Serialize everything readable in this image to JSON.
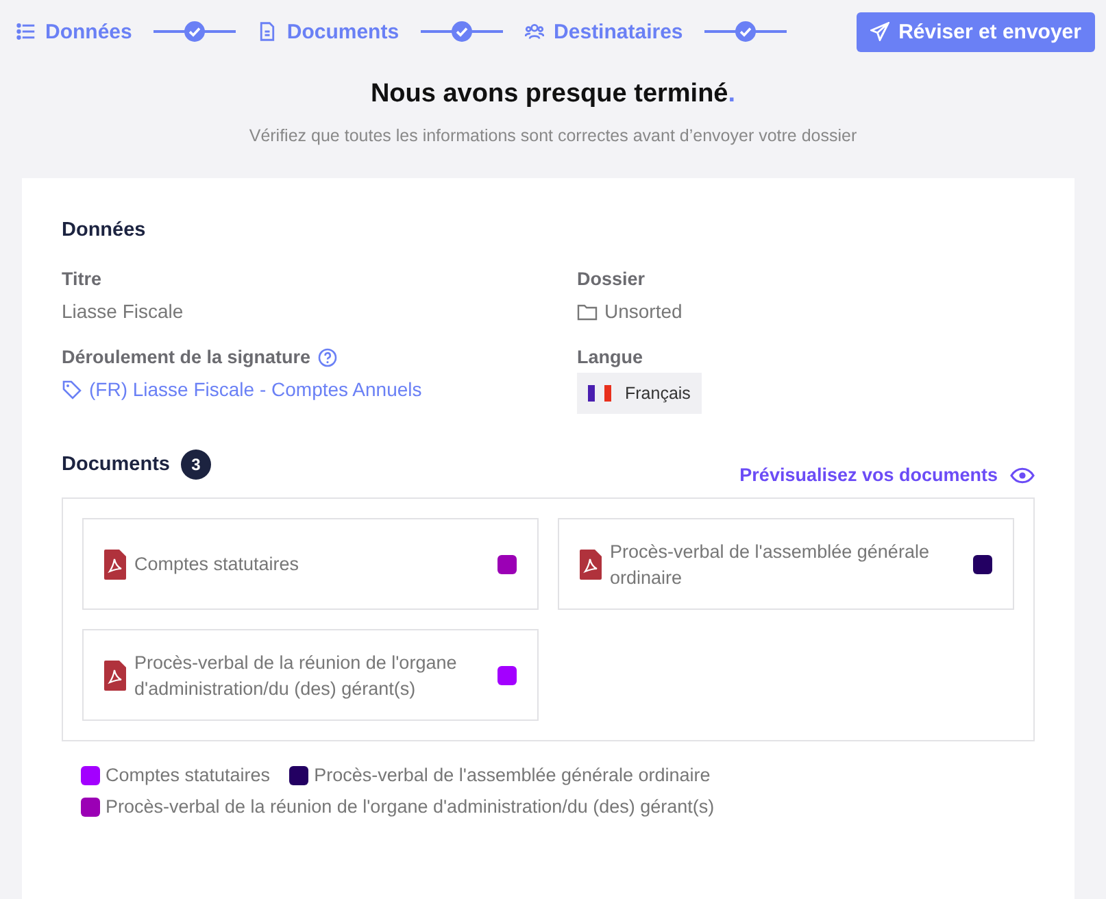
{
  "steps": [
    {
      "label": "Données",
      "kind": "list",
      "selected": false
    },
    {
      "label": "Documents",
      "kind": "file",
      "selected": false
    },
    {
      "label": "Destinataires",
      "kind": "users",
      "selected": false
    },
    {
      "label": "Réviser et envoyer",
      "kind": "send",
      "selected": true
    }
  ],
  "connectors": [
    {
      "checked": true
    },
    {
      "checked": true
    },
    {
      "checked": true
    }
  ],
  "heading": {
    "title": "Nous avons presque terminé",
    "accent": ".",
    "subtitle": "Vérifiez que toutes les informations sont correctes avant d’envoyer votre dossier"
  },
  "data_section": {
    "title": "Données",
    "fields": [
      {
        "label": "Titre",
        "value": "Liasse Fiscale",
        "kind": "text"
      },
      {
        "label": "Dossier",
        "value": "Unsorted",
        "kind": "folder"
      },
      {
        "label": "Déroulement de la signature",
        "value": "(FR) Liasse Fiscale - Comptes Annuels",
        "kind": "tag",
        "help": true
      },
      {
        "label": "Langue",
        "value": "Français",
        "kind": "language"
      }
    ]
  },
  "documents": {
    "title": "Documents",
    "count": "3",
    "preview_link": "Prévisualisez vos documents",
    "items": [
      {
        "name": "Comptes statutaires",
        "color": "#9b00b5"
      },
      {
        "name": "Procès-verbal de l'assemblée générale ordinaire",
        "color": "#230062"
      },
      {
        "name": "Procès-verbal de la réunion de l'organe d'administration/du (des) gérant(s)",
        "color": "#a300ff"
      }
    ],
    "legend": [
      {
        "name": "Comptes statutaires",
        "color": "#a300ff"
      },
      {
        "name": "Procès-verbal de l'assemblée générale ordinaire",
        "color": "#230062"
      },
      {
        "name": "Procès-verbal de la réunion de l'organe d'administration/du (des) gérant(s)",
        "color": "#9b00b5"
      }
    ]
  }
}
